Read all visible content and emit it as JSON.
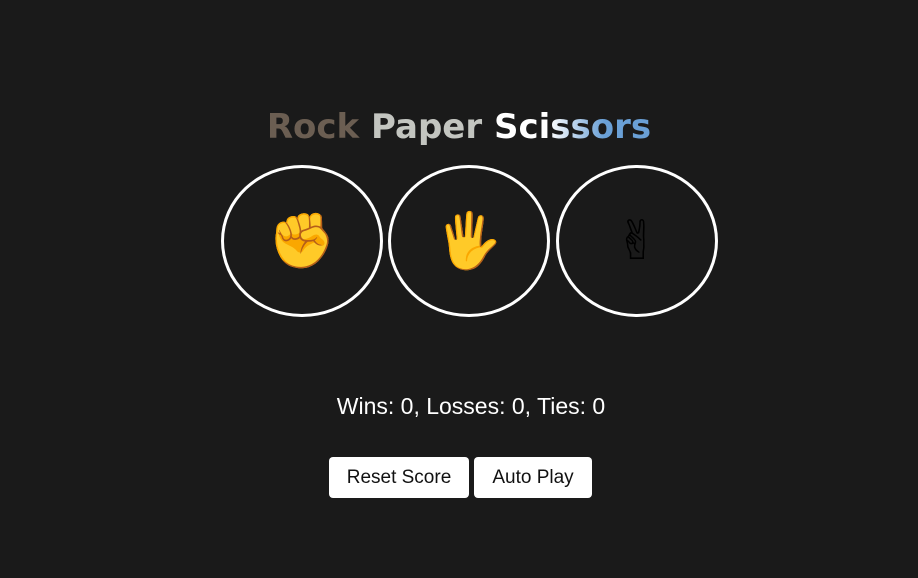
{
  "title": {
    "word1": "Rock",
    "word2": "Paper",
    "word3": "Scissors",
    "colors": {
      "rock": "#6b5e52",
      "paper": "#c3c5c0",
      "scissors_start": "#ffffff",
      "scissors_end": "#6aa0d6"
    }
  },
  "choices": [
    {
      "name": "rock",
      "emoji": "✊",
      "icon": "rock-fist-icon"
    },
    {
      "name": "paper",
      "emoji": "🖐",
      "icon": "paper-hand-icon"
    },
    {
      "name": "scissors",
      "emoji": "✌",
      "icon": "scissors-victory-hand-icon"
    }
  ],
  "score": {
    "text": "Wins: 0, Losses: 0, Ties: 0",
    "wins": 0,
    "losses": 0,
    "ties": 0
  },
  "buttons": {
    "reset_label": "Reset Score",
    "auto_play_label": "Auto Play"
  },
  "theme": {
    "background": "#1a1a1a",
    "foreground": "#ffffff",
    "emoji_color": "#f5b92e"
  }
}
